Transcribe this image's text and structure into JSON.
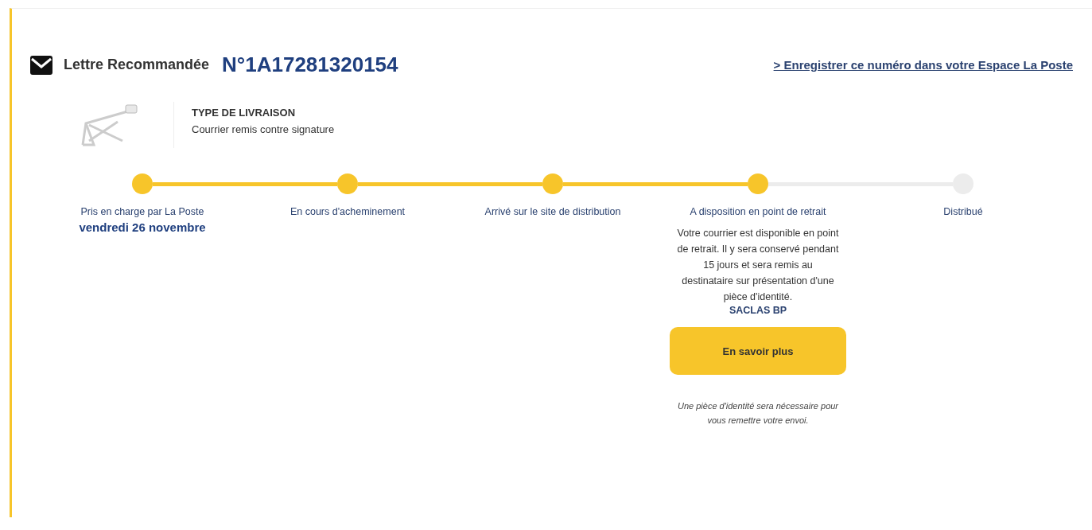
{
  "header": {
    "type": "Lettre Recommandée",
    "number": "N°1A17281320154",
    "link": "> Enregistrer ce numéro dans votre Espace La Poste"
  },
  "delivery": {
    "title": "TYPE DE LIVRAISON",
    "text": "Courrier remis contre signature"
  },
  "steps": [
    {
      "label": "Pris en charge par La Poste",
      "done": true,
      "date": "vendredi 26 novembre"
    },
    {
      "label": "En cours d'acheminement",
      "done": true
    },
    {
      "label": "Arrivé sur le site de distribution",
      "done": true
    },
    {
      "label": "A disposition en point de retrait",
      "done": true,
      "details": "Votre courrier est disponible en point de retrait. Il y sera conservé pendant 15 jours et sera remis au destinataire sur présentation d'une pièce d'identité.",
      "place": "SACLAS BP",
      "button": "En savoir plus",
      "note": "Une pièce d'identité sera nécessaire pour vous remettre votre envoi."
    },
    {
      "label": "Distribué",
      "done": false
    }
  ]
}
